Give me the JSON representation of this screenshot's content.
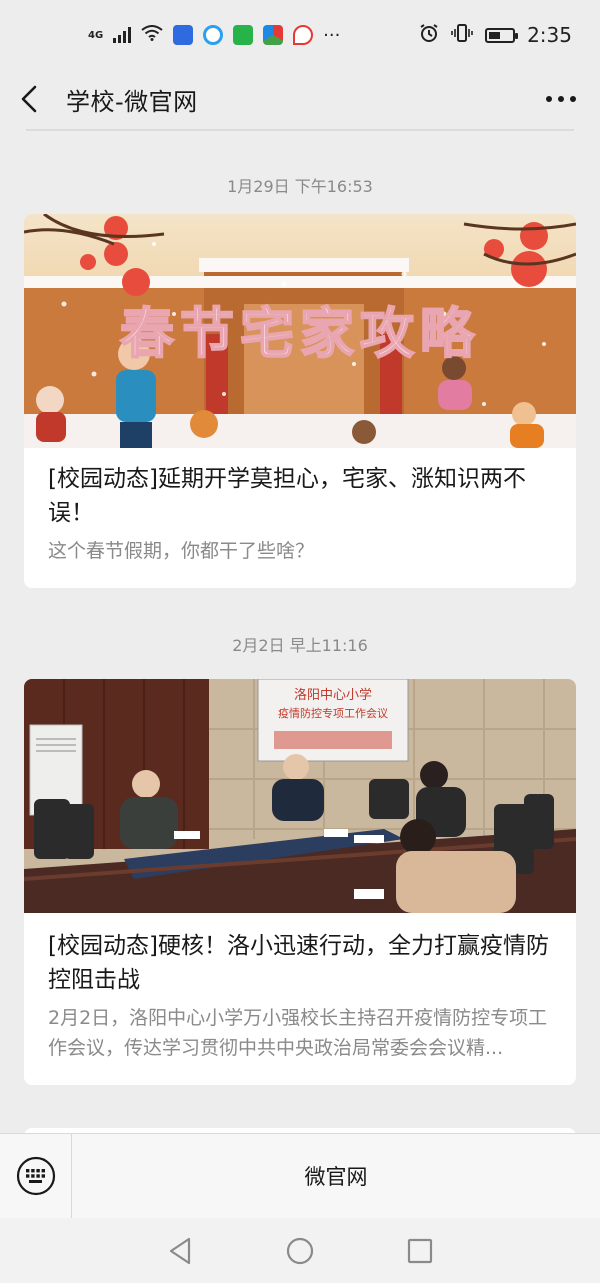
{
  "status_bar": {
    "network": "4G",
    "more": "···",
    "time": "2:35"
  },
  "header": {
    "title": "学校-微官网"
  },
  "feed": [
    {
      "time": "1月29日 下午16:53",
      "title": "[校园动态]延期开学莫担心，宅家、涨知识两不误！",
      "desc": "这个春节假期，你都干了些啥？",
      "image_text": "春节宅家攻略"
    },
    {
      "time": "2月2日 早上11:16",
      "title": "[校园动态]硬核！洛小迅速行动，全力打赢疫情防控阻击战",
      "desc": "2月2日，洛阳中心小学万小强校长主持召开疫情防控专项工作会议，传达学习贯彻中共中央政治局常委会会议精...",
      "image_banner_line1": "洛阳中心小学",
      "image_banner_line2": "疫情防控专项工作会议"
    }
  ],
  "menu": {
    "keyboard_icon": "keyboard-icon",
    "item_label": "微官网"
  },
  "colors": {
    "background": "#ededed",
    "card": "#ffffff",
    "secondary_text": "#8a8a8a"
  }
}
